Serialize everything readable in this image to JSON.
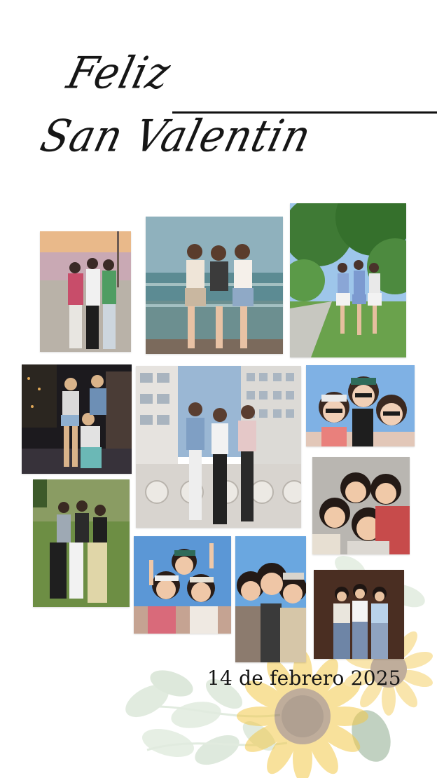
{
  "title": {
    "line1": "Feliz",
    "line2": "San Valentin"
  },
  "date": "14 de febrero 2025",
  "colors": {
    "ink": "#141414",
    "sunflower": "#f3c94a",
    "leaf": "#a9c6a4",
    "background": "#ffffff"
  },
  "photos": [
    {
      "name": "photo-boardwalk-sunset",
      "sky": "#e9b98a",
      "ground": "#b9b2a8",
      "people": 3
    },
    {
      "name": "photo-pier-ice-cream",
      "sky": "#8fb1bd",
      "ground": "#6c8f90",
      "people": 3
    },
    {
      "name": "photo-park-trees",
      "sky": "#9ec6ea",
      "ground": "#6aa24c",
      "people": 3
    },
    {
      "name": "photo-night-street",
      "sky": "#1c1a1e",
      "ground": "#37323a",
      "people": 3
    },
    {
      "name": "photo-city-bridge",
      "sky": "#9ab7d4",
      "ground": "#d8d4cf",
      "people": 3
    },
    {
      "name": "photo-sunglasses-selfie",
      "sky": "#7fb1e4",
      "ground": "#e2c7b8",
      "people": 3
    },
    {
      "name": "photo-garden-pose",
      "sky": "#8a9c63",
      "ground": "#6d8e44",
      "people": 3
    },
    {
      "name": "photo-indoor-selfie",
      "sky": "#b9b6b1",
      "ground": "#c74b4b",
      "people": 4
    },
    {
      "name": "photo-blue-sky-caps",
      "sky": "#5b97d6",
      "ground": "#d96a7a",
      "people": 3
    },
    {
      "name": "photo-close-selfie",
      "sky": "#6aa7e0",
      "ground": "#8c7b6e",
      "people": 3
    },
    {
      "name": "photo-brown-wall",
      "sky": "#4a2e22",
      "ground": "#6e85a6",
      "people": 3
    }
  ]
}
